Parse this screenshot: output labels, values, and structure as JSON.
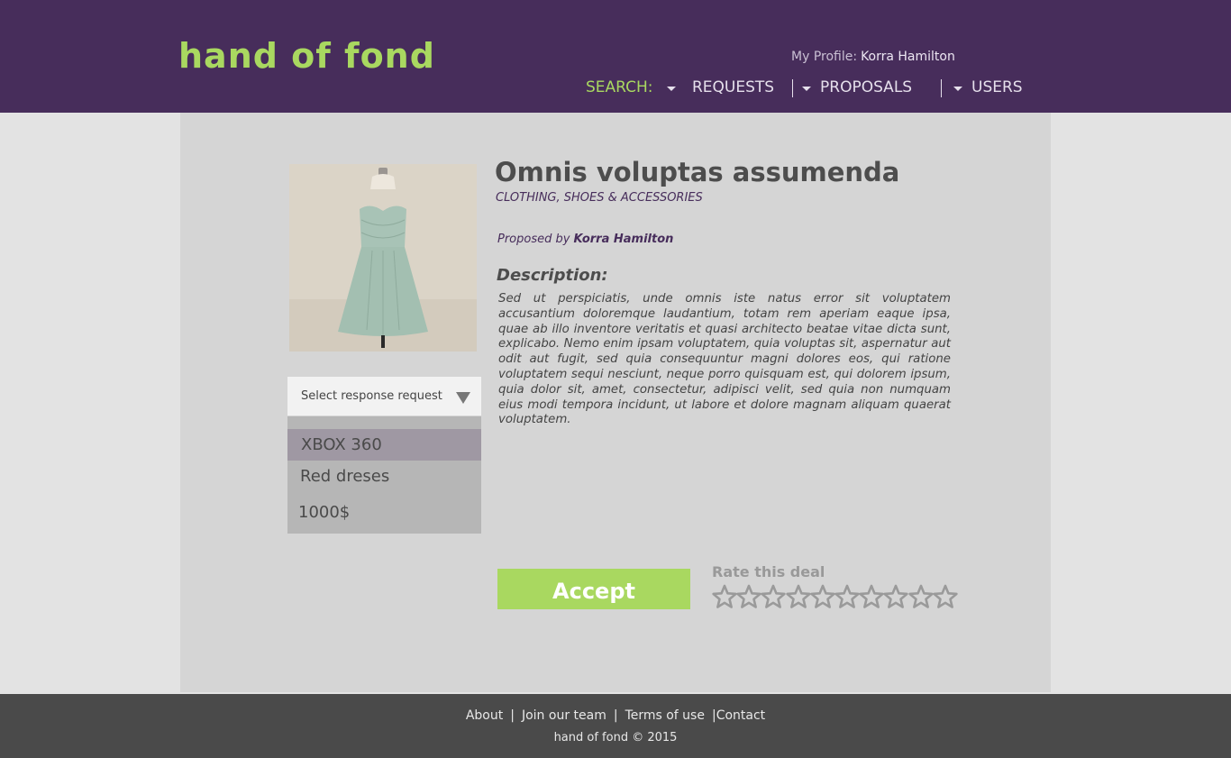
{
  "header": {
    "logo": "hand of fond",
    "profile_label": "My Profile:",
    "profile_name": "Korra Hamilton",
    "nav": {
      "search": "SEARCH:",
      "requests": "REQUESTS",
      "proposals": "PROPOSALS",
      "users": "USERS"
    }
  },
  "product": {
    "image_icon": "dress-image",
    "title": "Omnis voluptas assumenda",
    "category": "CLOTHING, SHOES & ACCESSORIES",
    "proposed_by_label": "Proposed by",
    "proposed_by_name": "Korra Hamilton",
    "description_label": "Description:",
    "description": "Sed ut perspiciatis, unde omnis iste natus error sit voluptatem accusantium doloremque laudantium, totam rem aperiam eaque ipsa, quae ab illo inventore veritatis et quasi architecto beatae vitae dicta sunt, explicabo. Nemo enim ipsam voluptatem, quia voluptas sit, aspernatur aut odit aut fugit, sed quia consequuntur magni dolores eos, qui ratione voluptatem sequi nesciunt, neque porro quisquam est, qui dolorem ipsum, quia dolor sit, amet, consectetur, adipisci velit, sed quia non numquam eius modi tempora incidunt, ut labore et dolore magnam aliquam quaerat voluptatem."
  },
  "response_select": {
    "placeholder": "Select response request",
    "options": [
      "XBOX 360",
      "Red dreses",
      "1000$"
    ]
  },
  "actions": {
    "accept_label": "Accept",
    "rate_label": "Rate this deal",
    "stars_total": 10,
    "stars_filled": 0
  },
  "footer": {
    "links": [
      "About",
      "Join our team",
      "Terms of use",
      "Contact"
    ],
    "separator": "|",
    "copyright": "hand of fond © 2015"
  },
  "colors": {
    "header_bg": "#472d5b",
    "accent_green": "#a9d860",
    "main_bg": "#d5d5d5",
    "footer_bg": "#4a4a4a"
  }
}
